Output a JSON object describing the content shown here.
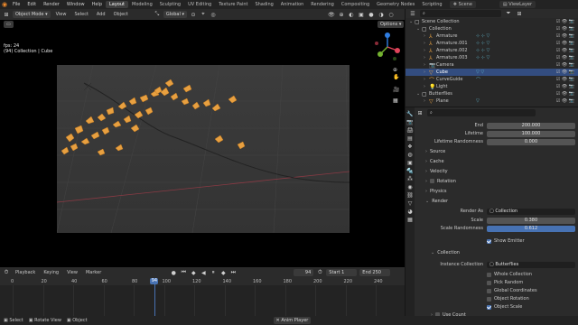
{
  "menu": {
    "items": [
      "File",
      "Edit",
      "Render",
      "Window",
      "Help"
    ],
    "workspaces": [
      "Layout",
      "Modeling",
      "Sculpting",
      "UV Editing",
      "Texture Paint",
      "Shading",
      "Animation",
      "Rendering",
      "Compositing",
      "Geometry Nodes",
      "Scripting"
    ],
    "active_workspace": "Layout",
    "scene_label": "Scene",
    "view_layer_label": "ViewLayer"
  },
  "viewport": {
    "mode": "Object Mode",
    "header_menus": [
      "View",
      "Select",
      "Add",
      "Object"
    ],
    "transform": "Global",
    "options_label": "Options",
    "fps": "fps: 24",
    "context": "(94) Collection | Cube"
  },
  "outliner": {
    "search_placeholder": "",
    "rows": [
      {
        "name": "Scene Collection",
        "indent": 0,
        "icon": "scene-collection-icon",
        "mods": "",
        "selected": false
      },
      {
        "name": "Collection",
        "indent": 1,
        "icon": "collection-icon",
        "mods": "",
        "selected": false
      },
      {
        "name": "Armature",
        "indent": 2,
        "icon": "armature-icon",
        "mods": "⊹ ⊹ ▽",
        "selected": false
      },
      {
        "name": "Armature.001",
        "indent": 2,
        "icon": "armature-icon",
        "mods": "⊹ ⊹ ▽",
        "selected": false
      },
      {
        "name": "Armature.002",
        "indent": 2,
        "icon": "armature-icon",
        "mods": "⊹ ⊹ ▽",
        "selected": false
      },
      {
        "name": "Armature.003",
        "indent": 2,
        "icon": "armature-icon",
        "mods": "⊹ ⊹ ▽",
        "selected": false
      },
      {
        "name": "Camera",
        "indent": 2,
        "icon": "camera-icon",
        "mods": "",
        "selected": false
      },
      {
        "name": "Cube",
        "indent": 2,
        "icon": "mesh-icon",
        "mods": "▽ ▽",
        "selected": true
      },
      {
        "name": "CurveGuide",
        "indent": 2,
        "icon": "curve-icon",
        "mods": "⌒",
        "selected": false
      },
      {
        "name": "Light",
        "indent": 2,
        "icon": "light-icon",
        "mods": "",
        "selected": false
      },
      {
        "name": "Butterflies",
        "indent": 1,
        "icon": "collection-icon",
        "mods": "",
        "selected": false
      },
      {
        "name": "Plane",
        "indent": 2,
        "icon": "mesh-icon",
        "mods": "▽",
        "selected": false
      }
    ]
  },
  "properties": {
    "fields": [
      {
        "label": "End",
        "value": "200.000",
        "style": "normal"
      },
      {
        "label": "Lifetime",
        "value": "100.000",
        "style": "normal"
      },
      {
        "label": "Lifetime Randomness",
        "value": "0.000",
        "style": "normal"
      }
    ],
    "sections": [
      "Source",
      "Cache",
      "Velocity",
      "Rotation",
      "Physics",
      "Render"
    ],
    "render": {
      "render_as_label": "Render As",
      "render_as_value": "Collection",
      "scale_label": "Scale",
      "scale_value": "0.380",
      "scale_rand_label": "Scale Randomness",
      "scale_rand_value": "0.612",
      "show_emitter": "Show Emitter"
    },
    "collection_section": "Collection",
    "instance_collection_label": "Instance Collection",
    "instance_collection_value": "Butterflies",
    "checks": [
      {
        "label": "Whole Collection",
        "on": false
      },
      {
        "label": "Pick Random",
        "on": false
      },
      {
        "label": "Global Coordinates",
        "on": false
      },
      {
        "label": "Object Rotation",
        "on": false
      },
      {
        "label": "Object Scale",
        "on": true
      }
    ],
    "use_count": "Use Count"
  },
  "timeline": {
    "menus": [
      "Playback",
      "Keying",
      "View",
      "Marker"
    ],
    "current_frame": "94",
    "start_label": "Start",
    "start_value": "1",
    "end_label": "End",
    "end_value": "250",
    "ticks": [
      "0",
      "20",
      "40",
      "60",
      "80",
      "100",
      "120",
      "140",
      "160",
      "180",
      "200",
      "220",
      "240"
    ],
    "playhead": "94"
  },
  "status": {
    "items": [
      "Select",
      "Rotate View",
      "Object"
    ],
    "center": "Anim Player"
  },
  "colors": {
    "accent": "#4772b3",
    "butterfly": "#e8a040",
    "selected_row": "#334d80"
  }
}
